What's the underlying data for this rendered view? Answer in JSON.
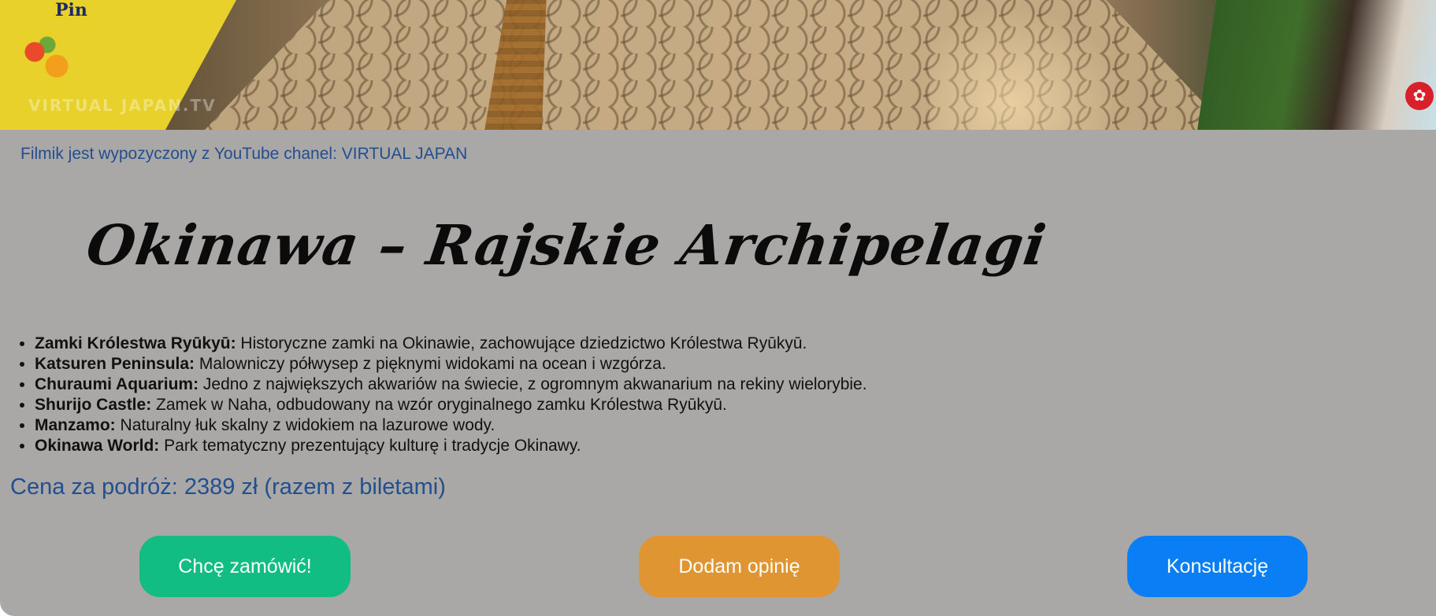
{
  "video": {
    "watermark": "VIRTUAL JAPAN.TV",
    "sign_text": "Pin",
    "badge_icon": "settings-badge-icon"
  },
  "credit": "Filmik jest wypozyczony z YouTube chanel: VIRTUAL JAPAN",
  "title": "Okinawa – Rajskie Archipelagi",
  "attractions": [
    {
      "name": "Zamki Królestwa Ryūkyū:",
      "desc": " Historyczne zamki na Okinawie, zachowujące dziedzictwo Królestwa Ryūkyū."
    },
    {
      "name": "Katsuren Peninsula:",
      "desc": " Malowniczy półwysep z pięknymi widokami na ocean i wzgórza."
    },
    {
      "name": "Churaumi Aquarium:",
      "desc": " Jedno z największych akwariów na świecie, z ogromnym akwanarium na rekiny wielorybie."
    },
    {
      "name": "Shurijo Castle:",
      "desc": " Zamek w Naha, odbudowany na wzór oryginalnego zamku Królestwa Ryūkyū."
    },
    {
      "name": "Manzamo:",
      "desc": " Naturalny łuk skalny z widokiem na lazurowe wody."
    },
    {
      "name": "Okinawa World:",
      "desc": " Park tematyczny prezentujący kulturę i tradycje Okinawy."
    }
  ],
  "price": "Cena za podróż: 2389 zł (razem z biletami)",
  "buttons": {
    "order": "Chcę zamówić!",
    "review": "Dodam opinię",
    "consult": "Konsultację"
  },
  "colors": {
    "background": "#aaa7a7",
    "link_blue": "#214f8f",
    "order": "#12bd84",
    "review": "#e09533",
    "consult": "#0a7ff5"
  }
}
